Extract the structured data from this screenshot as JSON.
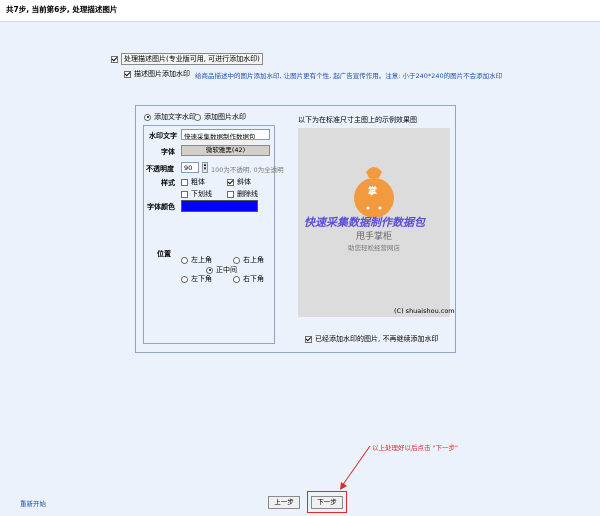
{
  "header": {
    "title": "共7步, 当前第6步, 处理描述图片"
  },
  "options": {
    "process_desc_images": "处理描述图片(专业版可用, 可进行添加水印)",
    "add_watermark": "描述图片添加水印",
    "hint": "给商品描述中的图片添加水印, 让图片更有个性, 起广告宣传作用。注意: 小于240*240的图片不会添加水印"
  },
  "watermark": {
    "type_text": "添加文字水印",
    "type_image": "添加图片水印",
    "text_label": "水印文字",
    "text_value": "快速采集数据制作数据包",
    "font_label": "字体",
    "font_value": "微软雅黑(42)",
    "opacity_label": "不透明度",
    "opacity_value": "90",
    "opacity_hint": "100为不透明, 0为全透明",
    "style_label": "样式",
    "bold": "粗体",
    "italic": "斜体",
    "underline": "下划线",
    "strikethrough": "删除线",
    "color_label": "字体颜色",
    "color_value": "#0000ff",
    "position_label": "位置",
    "pos_top_left": "左上角",
    "pos_top_right": "右上角",
    "pos_center": "正中间",
    "pos_bottom_left": "左下角",
    "pos_bottom_right": "右下角"
  },
  "preview": {
    "caption": "以下为在标准尺寸主图上的示例效果图",
    "logo_char": "掌",
    "watermark_text": "快速采集数据制作数据包",
    "brand": "甩手掌柜",
    "slogan": "助您轻松经营网店",
    "copyright": "(C) shuaishou.com",
    "skip_watermarked": "已经添加水印的图片, 不再继续添加水印"
  },
  "annotation": {
    "text": "以上处理好以后点击 \"下一步\""
  },
  "footer": {
    "restart": "重新开始",
    "prev": "上一步",
    "next": "下一步"
  }
}
